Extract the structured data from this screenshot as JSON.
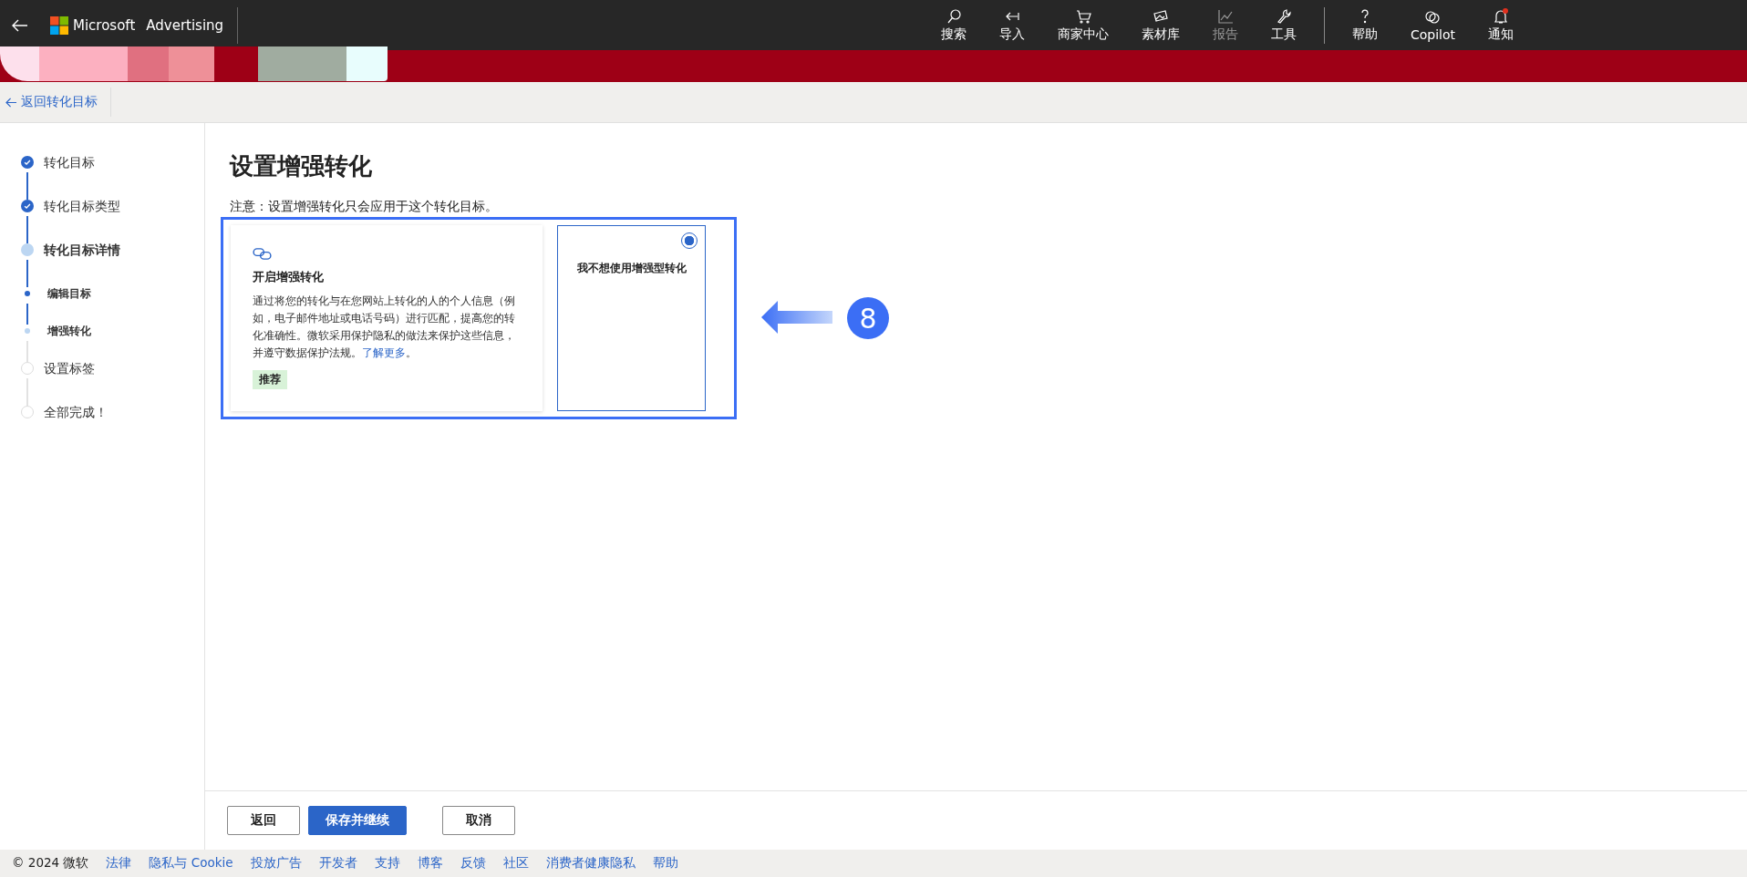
{
  "topbar": {
    "brand": "Microsoft",
    "product": "Advertising",
    "nav": [
      {
        "label": "搜索",
        "dimmed": false,
        "alert": false
      },
      {
        "label": "导入",
        "dimmed": false,
        "alert": false
      },
      {
        "label": "商家中心",
        "dimmed": false,
        "alert": false
      },
      {
        "label": "素材库",
        "dimmed": false,
        "alert": false
      },
      {
        "label": "报告",
        "dimmed": true,
        "alert": false
      },
      {
        "label": "工具",
        "dimmed": false,
        "alert": false
      },
      {
        "label": "帮助",
        "dimmed": false,
        "alert": false
      },
      {
        "label": "Copilot",
        "dimmed": false,
        "alert": false
      },
      {
        "label": "通知",
        "dimmed": false,
        "alert": true
      }
    ]
  },
  "breadcrumb": {
    "back_link": "返回转化目标"
  },
  "steps": [
    {
      "label": "转化目标",
      "done": true,
      "current": false
    },
    {
      "label": "转化目标类型",
      "done": true,
      "current": false
    },
    {
      "label": "转化目标详情",
      "done": false,
      "current": true,
      "children": [
        {
          "label": "编辑目标",
          "done": true,
          "current": false
        },
        {
          "label": "增强转化",
          "done": false,
          "current": true
        }
      ]
    },
    {
      "label": "设置标签",
      "done": false,
      "current": false
    },
    {
      "label": "全部完成！",
      "done": false,
      "current": false
    }
  ],
  "page": {
    "title": "设置增强转化",
    "note": "注意：设置增强转化只会应用于这个转化目标。"
  },
  "options": [
    {
      "kind": "feature",
      "selected": false,
      "title": "开启增强转化",
      "description": "通过将您的转化与在您网站上转化的人的个人信息（例如，电子邮件地址或电话号码）进行匹配，提高您的转化准确性。微软采用保护隐私的做法来保护这些信息，并遵守数据保护法规。",
      "link": "了解更多",
      "after_link": "。",
      "tag": "推荐"
    },
    {
      "kind": "plain",
      "selected": true,
      "title": "我不想使用增强型转化"
    }
  ],
  "annotation": {
    "number": "8"
  },
  "actions": [
    {
      "label": "返回",
      "primary": false
    },
    {
      "label": "保存并继续",
      "primary": true
    },
    {
      "label": "取消",
      "primary": false
    }
  ],
  "footer": {
    "copyright": "© 2024 微软",
    "links": [
      "法律",
      "隐私与 Cookie",
      "投放广告",
      "开发者",
      "支持",
      "博客",
      "反馈",
      "社区",
      "消费者健康隐私",
      "帮助"
    ]
  }
}
